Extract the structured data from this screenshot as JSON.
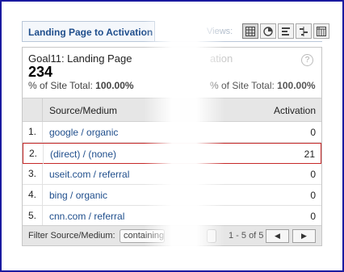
{
  "tab": {
    "label": "Landing Page to Activation"
  },
  "views": {
    "label": "Views:",
    "buttons": [
      {
        "icon": "table-grid-icon",
        "active": true
      },
      {
        "icon": "pie-chart-icon",
        "active": false
      },
      {
        "icon": "bar-list-icon",
        "active": false
      },
      {
        "icon": "comparison-icon",
        "active": false
      },
      {
        "icon": "pivot-icon",
        "active": false
      }
    ]
  },
  "summary": {
    "goal_title": "Goal11: Landing Page",
    "goal_value": "234",
    "goal_pct_label": "% of Site Total:",
    "goal_pct_value": "100.00%",
    "act_title": "ation",
    "act_pct_label": "% of Site Total:",
    "act_pct_value": "100.00%",
    "help": "?"
  },
  "table": {
    "headers": [
      "Source/Medium",
      "Activation"
    ],
    "rows": [
      {
        "index": "1.",
        "source": "google / organic",
        "value": "0"
      },
      {
        "index": "2.",
        "source": "(direct) / (none)",
        "value": "21",
        "highlighted": true
      },
      {
        "index": "3.",
        "source": "useit.com / referral",
        "value": "0"
      },
      {
        "index": "4.",
        "source": "bing / organic",
        "value": "0"
      },
      {
        "index": "5.",
        "source": "cnn.com / referral",
        "value": "0"
      }
    ]
  },
  "footer": {
    "filter_label": "Filter Source/Medium:",
    "filter_select": "containing",
    "range": "1 - 5 of 5",
    "prev": "◀",
    "next": "▶"
  },
  "colors": {
    "link": "#1f4e8c",
    "highlight_border": "#c62828",
    "frame": "#1a1aa0"
  }
}
